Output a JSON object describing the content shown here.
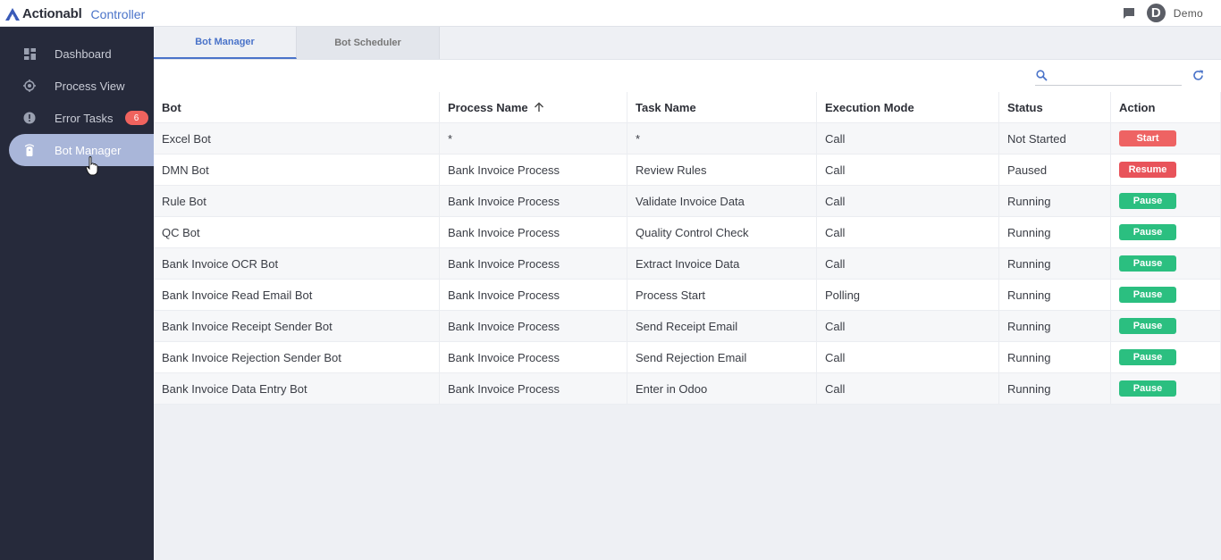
{
  "header": {
    "brand_name": "Actionabl",
    "brand_sub": "Controller",
    "user_initial": "D",
    "user_name": "Demo"
  },
  "sidebar": {
    "items": [
      {
        "label": "Dashboard",
        "icon": "dashboard-icon"
      },
      {
        "label": "Process View",
        "icon": "process-view-icon"
      },
      {
        "label": "Error Tasks",
        "icon": "error-icon",
        "badge": "6"
      },
      {
        "label": "Bot Manager",
        "icon": "bot-icon",
        "active": true
      }
    ]
  },
  "tabs": [
    {
      "label": "Bot Manager",
      "active": true
    },
    {
      "label": "Bot Scheduler",
      "active": false
    }
  ],
  "search": {
    "placeholder": "",
    "value": ""
  },
  "table": {
    "headers": [
      "Bot",
      "Process Name",
      "Task Name",
      "Execution Mode",
      "Status",
      "Action"
    ],
    "sorted_column": "Process Name",
    "sort_direction": "ascending",
    "rows": [
      {
        "bot": "Excel Bot",
        "process": "*",
        "task": "*",
        "mode": "Call",
        "status": "Not Started",
        "action": "Start",
        "action_color": "#ee6363"
      },
      {
        "bot": "DMN Bot",
        "process": "Bank Invoice Process",
        "task": "Review Rules",
        "mode": "Call",
        "status": "Paused",
        "action": "Resume",
        "action_color": "#e8535a"
      },
      {
        "bot": "Rule Bot",
        "process": "Bank Invoice Process",
        "task": "Validate Invoice Data",
        "mode": "Call",
        "status": "Running",
        "action": "Pause",
        "action_color": "#2bbf80"
      },
      {
        "bot": "QC Bot",
        "process": "Bank Invoice Process",
        "task": "Quality Control Check",
        "mode": "Call",
        "status": "Running",
        "action": "Pause",
        "action_color": "#2bbf80"
      },
      {
        "bot": "Bank Invoice OCR Bot",
        "process": "Bank Invoice Process",
        "task": "Extract Invoice Data",
        "mode": "Call",
        "status": "Running",
        "action": "Pause",
        "action_color": "#2bbf80"
      },
      {
        "bot": "Bank Invoice Read Email Bot",
        "process": "Bank Invoice Process",
        "task": "Process Start",
        "mode": "Polling",
        "status": "Running",
        "action": "Pause",
        "action_color": "#2bbf80"
      },
      {
        "bot": "Bank Invoice Receipt Sender Bot",
        "process": "Bank Invoice Process",
        "task": "Send Receipt Email",
        "mode": "Call",
        "status": "Running",
        "action": "Pause",
        "action_color": "#2bbf80"
      },
      {
        "bot": "Bank Invoice Rejection Sender Bot",
        "process": "Bank Invoice Process",
        "task": "Send Rejection Email",
        "mode": "Call",
        "status": "Running",
        "action": "Pause",
        "action_color": "#2bbf80"
      },
      {
        "bot": "Bank Invoice Data Entry Bot",
        "process": "Bank Invoice Process",
        "task": "Enter in Odoo",
        "mode": "Call",
        "status": "Running",
        "action": "Pause",
        "action_color": "#2bbf80"
      }
    ]
  },
  "colors": {
    "sidebar_bg": "#262a3b",
    "accent": "#4a73c9",
    "active_item": "#a9b6d9",
    "badge": "#f0635e"
  }
}
